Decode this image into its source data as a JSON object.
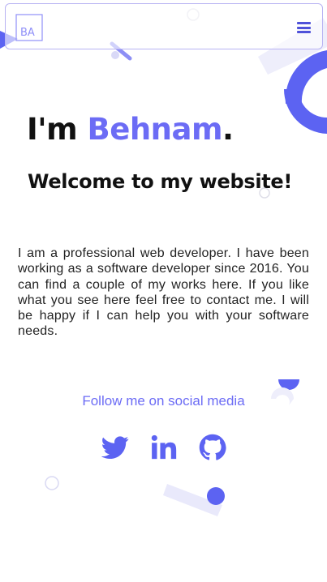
{
  "header": {
    "logo_text": "BA",
    "menu_icon": "hamburger-menu-icon"
  },
  "hero": {
    "greeting_prefix": "I'm",
    "name": "Behnam",
    "punct": ".",
    "subtitle": "Welcome to my website!",
    "bio": "I am a professional web developer. I have been working as a software developer since 2016. You can find a couple of my works here. If you like what you see here feel free to contact me. I will be happy if I can help you with your software needs."
  },
  "social": {
    "heading": "Follow me on social media",
    "icons": [
      "twitter-icon",
      "linkedin-icon",
      "github-icon"
    ]
  },
  "colors": {
    "accent": "#6c6cf5",
    "menu": "#4f52d9",
    "shape_light": "#eeeefb",
    "text": "#111111"
  }
}
